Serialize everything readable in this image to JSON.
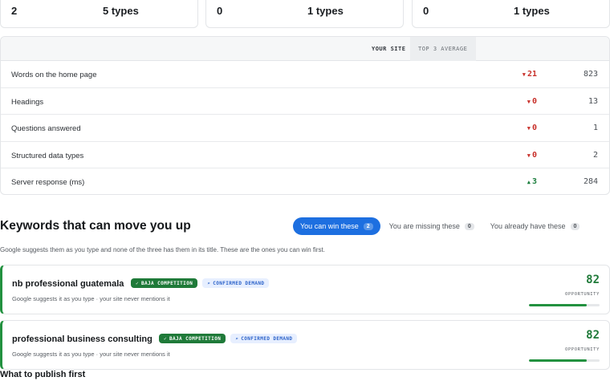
{
  "summary_cards": [
    {
      "number": "2",
      "types": "5 types"
    },
    {
      "number": "0",
      "types": "1 types"
    },
    {
      "number": "0",
      "types": "1 types"
    }
  ],
  "comparison": {
    "your_site_header": "YOUR SITE",
    "average_header": "TOP 3 AVERAGE",
    "rows": [
      {
        "label": "Words on the home page",
        "delta": "21",
        "direction": "down",
        "average": "823"
      },
      {
        "label": "Headings",
        "delta": "0",
        "direction": "down",
        "average": "13"
      },
      {
        "label": "Questions answered",
        "delta": "0",
        "direction": "down",
        "average": "1"
      },
      {
        "label": "Structured data types",
        "delta": "0",
        "direction": "down",
        "average": "2"
      },
      {
        "label": "Server response (ms)",
        "delta": "3",
        "direction": "up",
        "average": "284"
      }
    ]
  },
  "keywords": {
    "title": "Keywords that can move you up",
    "subtitle": "Google suggests them as you type and none of the three has them in its title. These are the ones you can win first.",
    "tabs": [
      {
        "label": "You can win these",
        "count": "2",
        "active": true
      },
      {
        "label": "You are missing these",
        "count": "0",
        "active": false
      },
      {
        "label": "You already have these",
        "count": "0",
        "active": false
      }
    ],
    "items": [
      {
        "name": "nb professional guatemala",
        "badge_competition": "BAJA COMPETITION",
        "badge_demand": "CONFIRMED DEMAND",
        "description": "Google suggests it as you type · your site never mentions it",
        "score": "82",
        "score_label": "OPPORTUNITY",
        "score_fraction": 0.82
      },
      {
        "name": "professional business consulting",
        "badge_competition": "BAJA COMPETITION",
        "badge_demand": "CONFIRMED DEMAND",
        "description": "Google suggests it as you type · your site never mentions it",
        "score": "82",
        "score_label": "OPPORTUNITY",
        "score_fraction": 0.82
      }
    ]
  },
  "publish": {
    "title": "What to publish first"
  },
  "colors": {
    "accent": "#1d6fe0",
    "positive": "#1f7a39",
    "negative": "#c8302a"
  }
}
